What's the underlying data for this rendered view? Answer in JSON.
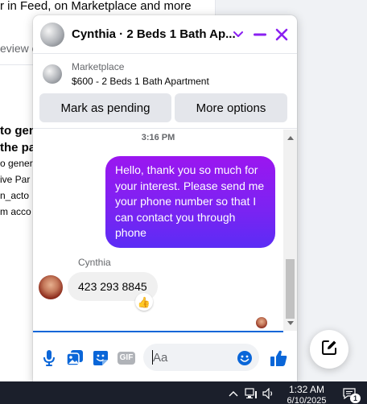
{
  "background_page": {
    "top_text": "r in Feed, on Marketplace and more",
    "review_text": "eview o",
    "bold_line_1": "to gen",
    "bold_line_2": "the pa",
    "small_line_1": "o gener",
    "small_line_2": "ive Par",
    "small_line_3": "n_acto",
    "small_line_4": "m acco"
  },
  "chat": {
    "title": "Cynthia · 2 Beds 1 Bath Ap...",
    "listing": {
      "source": "Marketplace",
      "title": "$600 - 2 Beds 1 Bath Apartment"
    },
    "buttons": {
      "mark_pending": "Mark as pending",
      "more_options": "More options"
    },
    "messages": {
      "timestamp": "3:16 PM",
      "outgoing": "Hello, thank you so much for your interest. Please send me your phone number so that I can contact you through phone",
      "sender_name": "Cynthia",
      "incoming": "423 293 8845",
      "reaction": "👍"
    },
    "composer": {
      "placeholder": "Aa",
      "gif_label": "GIF"
    },
    "colors": {
      "accent": "#8a20f1",
      "bubble_gradient_top": "#9b16f0",
      "bubble_gradient_bottom": "#5b2cf5",
      "like_blue": "#0a66d8"
    }
  },
  "taskbar": {
    "time": "1:32 AM",
    "date": "6/10/2025",
    "notification_count": "1"
  },
  "icons": {
    "header": [
      "chevron-down-icon",
      "minimize-icon",
      "close-icon"
    ],
    "composer": [
      "microphone-icon",
      "photo-icon",
      "sticker-icon",
      "gif-icon",
      "emoji-icon",
      "thumbs-up-icon"
    ],
    "floating": "compose-icon",
    "tray": [
      "chevron-up-icon",
      "network-icon",
      "volume-icon",
      "notification-icon"
    ]
  }
}
